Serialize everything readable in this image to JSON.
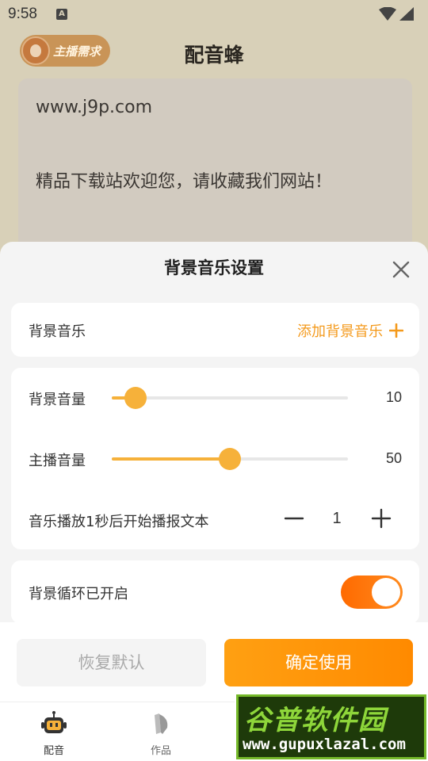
{
  "status_bar": {
    "time": "9:58",
    "notification_letter": "A",
    "icons": [
      "wifi-icon",
      "cell-signal-icon"
    ]
  },
  "app": {
    "title": "配音蜂",
    "anchor_badge_label": "主播需求",
    "text_content": {
      "line1": "www.j9p.com",
      "line2": "精品下载站欢迎您，请收藏我们网站！"
    }
  },
  "sheet": {
    "title": "背景音乐设置",
    "background_music": {
      "label": "背景音乐",
      "add_label": "添加背景音乐"
    },
    "bg_volume": {
      "label": "背景音量",
      "value": "10",
      "level": 0.1
    },
    "anchor_volume": {
      "label": "主播音量",
      "value": "50",
      "level": 0.5
    },
    "delay": {
      "label": "音乐播放1秒后开始播报文本",
      "value": "1"
    },
    "loop": {
      "label": "背景循环已开启",
      "enabled": true
    }
  },
  "actions": {
    "reset_label": "恢复默认",
    "confirm_label": "确定使用"
  },
  "tabbar": {
    "tabs": [
      {
        "label": "配音",
        "icon": "robot-icon"
      },
      {
        "label": "作品",
        "icon": "works-icon"
      }
    ]
  },
  "watermark": {
    "title": "谷普软件园",
    "url": "www.gupuxlazal.com"
  },
  "colors": {
    "accent": "#f49a1c",
    "slider": "#f6b13a",
    "toggle_on": "#ff6a00"
  }
}
